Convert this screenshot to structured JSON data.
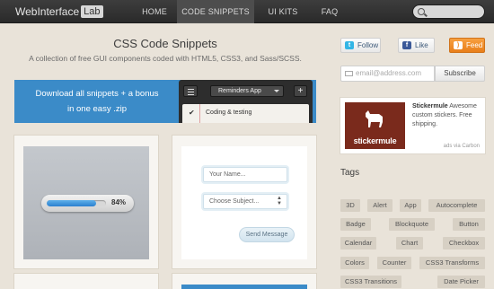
{
  "header": {
    "logo_main": "WebInterface",
    "logo_badge": "Lab",
    "nav": [
      "HOME",
      "CODE SNIPPETS",
      "UI KITS",
      "FAQ"
    ],
    "active_nav": "CODE SNIPPETS"
  },
  "hero": {
    "title": "CSS Code Snippets",
    "subtitle": "A collection of free GUI components coded with HTML5, CSS3, and Sass/SCSS."
  },
  "banner": {
    "line1": "Download all snippets + a bonus",
    "line2": "in one easy .zip",
    "mock_app": "Reminders App",
    "mock_plus": "+",
    "mock_task": "Coding & testing",
    "mock_check": "✔"
  },
  "cards": {
    "progress_label": "84%",
    "progress_value": 0.84,
    "name_placeholder": "Your Name...",
    "subject_placeholder": "Choose Subject...",
    "send_label": "Send Message"
  },
  "sidebar": {
    "follow_label": "Follow",
    "like_label": "Like",
    "feed_label": "Feed",
    "email_placeholder": "email@address.com",
    "subscribe_label": "Subscribe",
    "ad": {
      "brand_name": "Stickermule",
      "brand_logo_text": "stickermule",
      "description": "Awesome custom stickers. Free shipping.",
      "credit": "ads via Carbon"
    },
    "tags_heading": "Tags",
    "tags": [
      "3D",
      "Alert",
      "App",
      "Autocomplete",
      "Badge",
      "Blockquote",
      "Button",
      "Calendar",
      "Chart",
      "Checkbox",
      "Colors",
      "Counter",
      "CSS3 Transforms",
      "CSS3 Transitions",
      "Date Picker"
    ]
  },
  "colors": {
    "accent": "#3b8bc8",
    "nav_bg": "#2f2f2f",
    "page_bg": "#e9e3d9",
    "feed": "#ef8a24",
    "ad_bg": "#7a2a1c"
  }
}
